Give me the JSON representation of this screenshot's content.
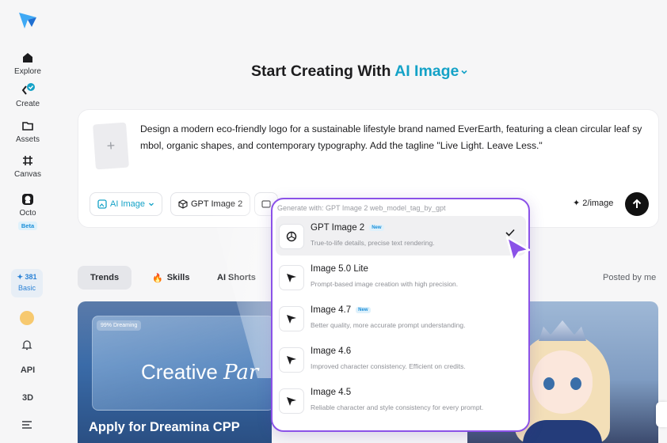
{
  "sidebar": {
    "items": [
      {
        "label": "Explore",
        "icon": "home-icon"
      },
      {
        "label": "Create",
        "icon": "create-icon"
      },
      {
        "label": "Assets",
        "icon": "folder-icon"
      },
      {
        "label": "Canvas",
        "icon": "canvas-icon"
      },
      {
        "label": "Octo",
        "icon": "octo-icon",
        "badge": "Beta"
      }
    ],
    "credits": {
      "amount": "381",
      "plan": "Basic"
    },
    "bottom": {
      "api": "API",
      "three_d": "3D"
    }
  },
  "header": {
    "prefix": "Start Creating With",
    "accent": "AI Image",
    "accent_color": "#14a2c7"
  },
  "prompt": {
    "text": "Design a modern eco-friendly logo for a sustainable lifestyle brand named EverEarth, featuring a clean circular leaf sy mbol, organic shapes, and contemporary typography. Add the tagline \"Live Light. Leave Less.\"",
    "mode_label": "AI Image",
    "model_label": "GPT Image 2",
    "rate": "2/image"
  },
  "tabs": {
    "items": [
      "Trends",
      "Skills",
      "AI Shorts"
    ],
    "active": "Trends",
    "posted_by": "Posted by me"
  },
  "banner": {
    "tag": "99% Dreaming",
    "headline": "Creative",
    "headline_italic": "Par",
    "title": "Apply for Dreamina CPP"
  },
  "model_menu": {
    "header": "Generate with: GPT Image 2 web_model_tag_by_gpt",
    "accent_color": "#8b52e8",
    "items": [
      {
        "name": "GPT Image 2",
        "desc": "True-to-life details, precise text rendering.",
        "badge": "New",
        "selected": true
      },
      {
        "name": "Image 5.0 Lite",
        "desc": "Prompt-based image creation with high precision.",
        "badge": "",
        "selected": false
      },
      {
        "name": "Image 4.7",
        "desc": "Better quality, more accurate prompt understanding.",
        "badge": "New",
        "selected": false
      },
      {
        "name": "Image 4.6",
        "desc": "Improved character consistency. Efficient on credits.",
        "badge": "",
        "selected": false
      },
      {
        "name": "Image 4.5",
        "desc": "Reliable character and style consistency for every prompt.",
        "badge": "",
        "selected": false
      }
    ]
  }
}
